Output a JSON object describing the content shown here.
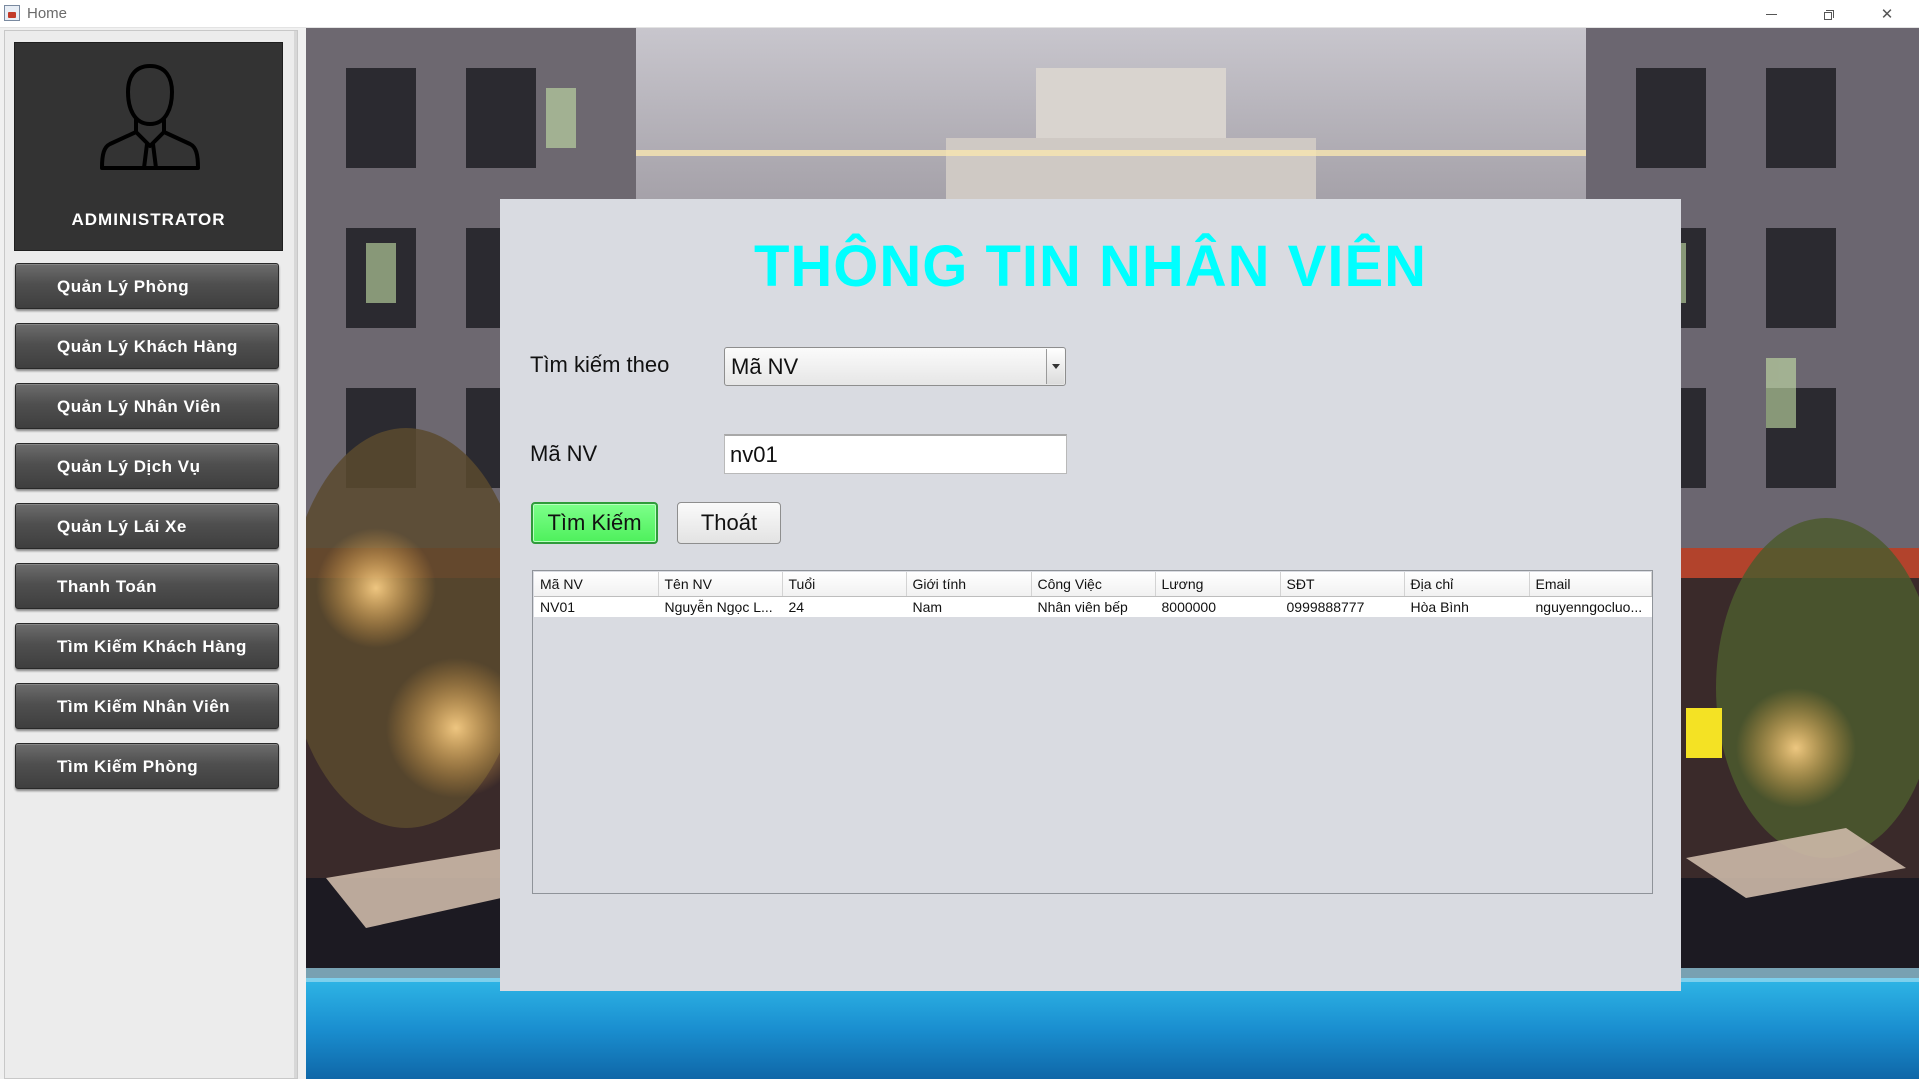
{
  "window": {
    "title": "Home",
    "minimize_glyph": "—",
    "close_glyph": "✕"
  },
  "sidebar": {
    "admin_label": "ADMINISTRATOR",
    "items": [
      {
        "label": "Quản Lý Phòng"
      },
      {
        "label": "Quản Lý Khách Hàng"
      },
      {
        "label": "Quản Lý Nhân Viên"
      },
      {
        "label": "Quản Lý Dịch Vụ"
      },
      {
        "label": "Quản Lý Lái Xe"
      },
      {
        "label": "Thanh Toán"
      },
      {
        "label": "Tìm Kiếm Khách Hàng"
      },
      {
        "label": "Tìm Kiếm Nhân Viên"
      },
      {
        "label": "Tìm Kiếm Phòng"
      }
    ]
  },
  "panel": {
    "title": "THÔNG TIN NHÂN VIÊN",
    "search_by_label": "Tìm kiếm theo",
    "search_by_value": "Mã NV",
    "field_label": "Mã NV",
    "field_value": "nv01",
    "search_button": "Tìm Kiếm",
    "exit_button": "Thoát"
  },
  "table": {
    "columns": [
      "Mã NV",
      "Tên NV",
      "Tuổi",
      "Giới tính",
      "Công Việc",
      "Lương",
      "SĐT",
      "Địa chỉ",
      "Email"
    ],
    "rows": [
      [
        "NV01",
        "Nguyễn Ngọc L...",
        "24",
        "Nam",
        "Nhân viên bếp",
        "8000000",
        "0999888777",
        "Hòa Bình",
        "nguyenngocluo..."
      ]
    ]
  },
  "colors": {
    "title_accent": "#00ffff",
    "search_button": "#5cf56a",
    "sidebar_button": "#4a4a4a",
    "panel_bg": "#d9dbe1"
  }
}
